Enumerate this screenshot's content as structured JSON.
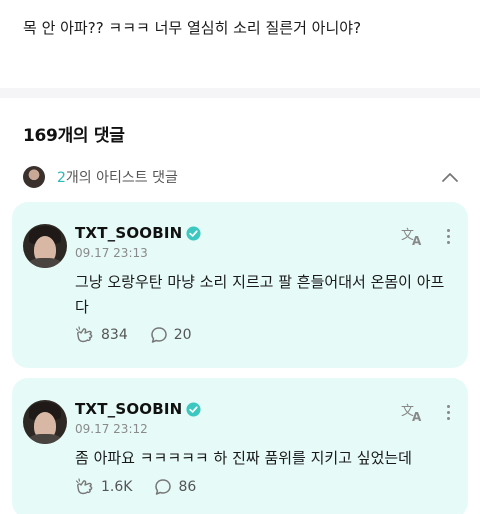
{
  "post": {
    "text": "목 안 아파?? ㅋㅋㅋ 너무 열심히 소리 질른거 아니야?"
  },
  "comments_header": {
    "label": "169개의 댓글"
  },
  "artist_section": {
    "count": "2",
    "label_suffix": "개의 아티스트 댓글"
  },
  "comments": [
    {
      "author": "TXT_SOOBIN",
      "timestamp": "09.17 23:13",
      "text": "그냥 오랑우탄 마냥 소리 지르고 팔 흔들어대서 온몸이 아프다",
      "likes": "834",
      "replies": "20"
    },
    {
      "author": "TXT_SOOBIN",
      "timestamp": "09.17 23:12",
      "text": "좀 아파요 ㅋㅋㅋㅋㅋ 하 진짜 품위를 지키고 싶었는데",
      "likes": "1.6K",
      "replies": "86"
    }
  ],
  "colors": {
    "accent": "#2bb8b8",
    "card_background": "#e6fbf7",
    "verified_badge": "#3cc8c0"
  },
  "icons": {
    "expand": "chevron-up-icon",
    "verified": "verified-check-icon",
    "translate": "translate-icon",
    "more": "more-vertical-icon",
    "like": "like-hands-icon",
    "reply": "comment-bubble-icon"
  }
}
